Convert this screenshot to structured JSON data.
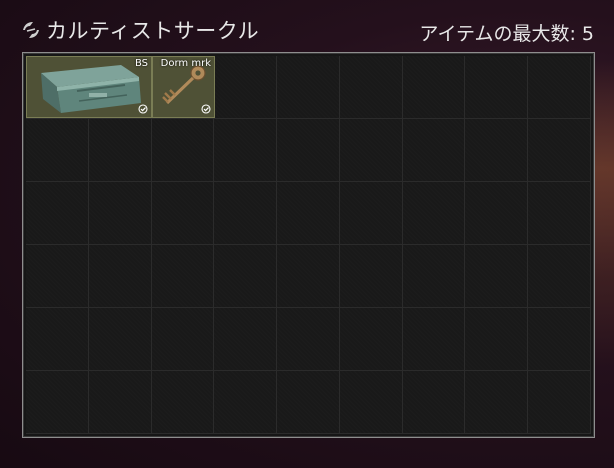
{
  "header": {
    "title": "カルティストサークル",
    "logo_icon": "cultist-circle-logo-icon",
    "max_items_label": "アイテムの最大数:",
    "max_items_value": "5"
  },
  "grid": {
    "columns": 9,
    "rows": 6
  },
  "items": [
    {
      "label": "BS",
      "icon": "ammo-box-icon",
      "checked": true,
      "check_icon": "checkmark-circle-icon"
    },
    {
      "label": "Dorm mrk",
      "icon": "key-icon",
      "checked": true,
      "check_icon": "checkmark-circle-icon"
    }
  ],
  "colors": {
    "item_bg": "#4f5136",
    "item_border": "#7a7d55",
    "frame_border": "#8e8e8e"
  }
}
